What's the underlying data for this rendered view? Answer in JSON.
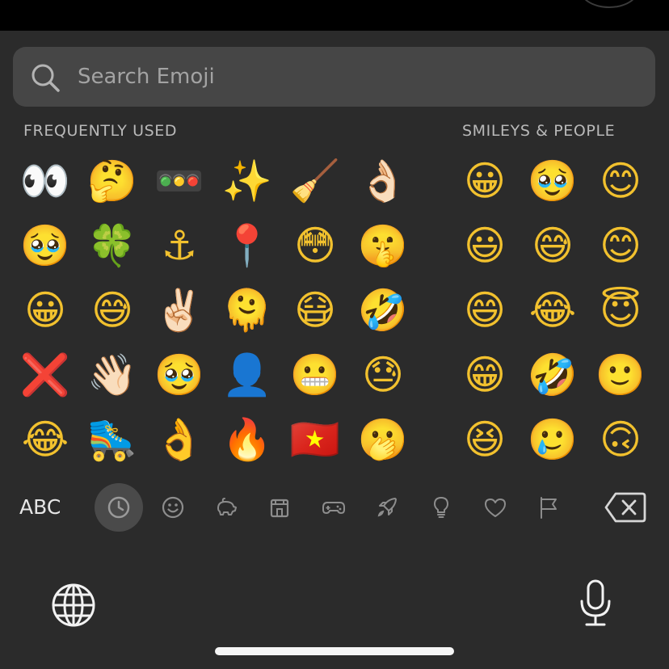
{
  "search": {
    "placeholder": "Search Emoji"
  },
  "sections": {
    "frequent_label": "FREQUENTLY USED",
    "smileys_label": "SMILEYS & PEOPLE"
  },
  "frequently_used": [
    [
      "👀",
      "🤔",
      "🚥",
      "✨",
      "🧹",
      "👌🏻"
    ],
    [
      "🥹",
      "🍀",
      "⚓",
      "📍",
      "😳",
      "🤫"
    ],
    [
      "😀",
      "😅",
      "✌🏻",
      "🫠",
      "😷",
      "🤣"
    ],
    [
      "❌",
      "👋🏻",
      "🥹",
      "👤",
      "😬",
      "😓"
    ],
    [
      "😂",
      "🛼",
      "👌",
      "🔥",
      "🇻🇳",
      "🫢"
    ]
  ],
  "smileys_people": [
    [
      "😀",
      "🥹",
      "😊",
      ""
    ],
    [
      "😃",
      "😅",
      "😊",
      ""
    ],
    [
      "😄",
      "😂",
      "😇",
      ""
    ],
    [
      "😁",
      "🤣",
      "🙂",
      ""
    ],
    [
      "😆",
      "🥲",
      "🙃",
      ""
    ]
  ],
  "category_bar": {
    "abc_label": "ABC",
    "categories": [
      {
        "icon": "clock-icon",
        "name": "recent",
        "active": true
      },
      {
        "icon": "smiley-icon",
        "name": "smileys-people",
        "active": false
      },
      {
        "icon": "animal-icon",
        "name": "animals-nature",
        "active": false
      },
      {
        "icon": "building-icon",
        "name": "places",
        "active": false
      },
      {
        "icon": "gamepad-icon",
        "name": "activity",
        "active": false
      },
      {
        "icon": "rocket-icon",
        "name": "travel",
        "active": false
      },
      {
        "icon": "lightbulb-icon",
        "name": "objects",
        "active": false
      },
      {
        "icon": "heart-icon",
        "name": "symbols",
        "active": false
      },
      {
        "icon": "flag-icon",
        "name": "flags",
        "active": false
      }
    ],
    "delete_icon": "delete-backspace-icon"
  },
  "bottom": {
    "globe_icon": "globe-icon",
    "mic_icon": "microphone-icon"
  },
  "colors": {
    "background": "#2b2b2b",
    "search_bar": "#464646",
    "section_label": "#b9b9b9",
    "icon_gray": "#9a9a9a",
    "active_category": "#4a4a4a"
  }
}
